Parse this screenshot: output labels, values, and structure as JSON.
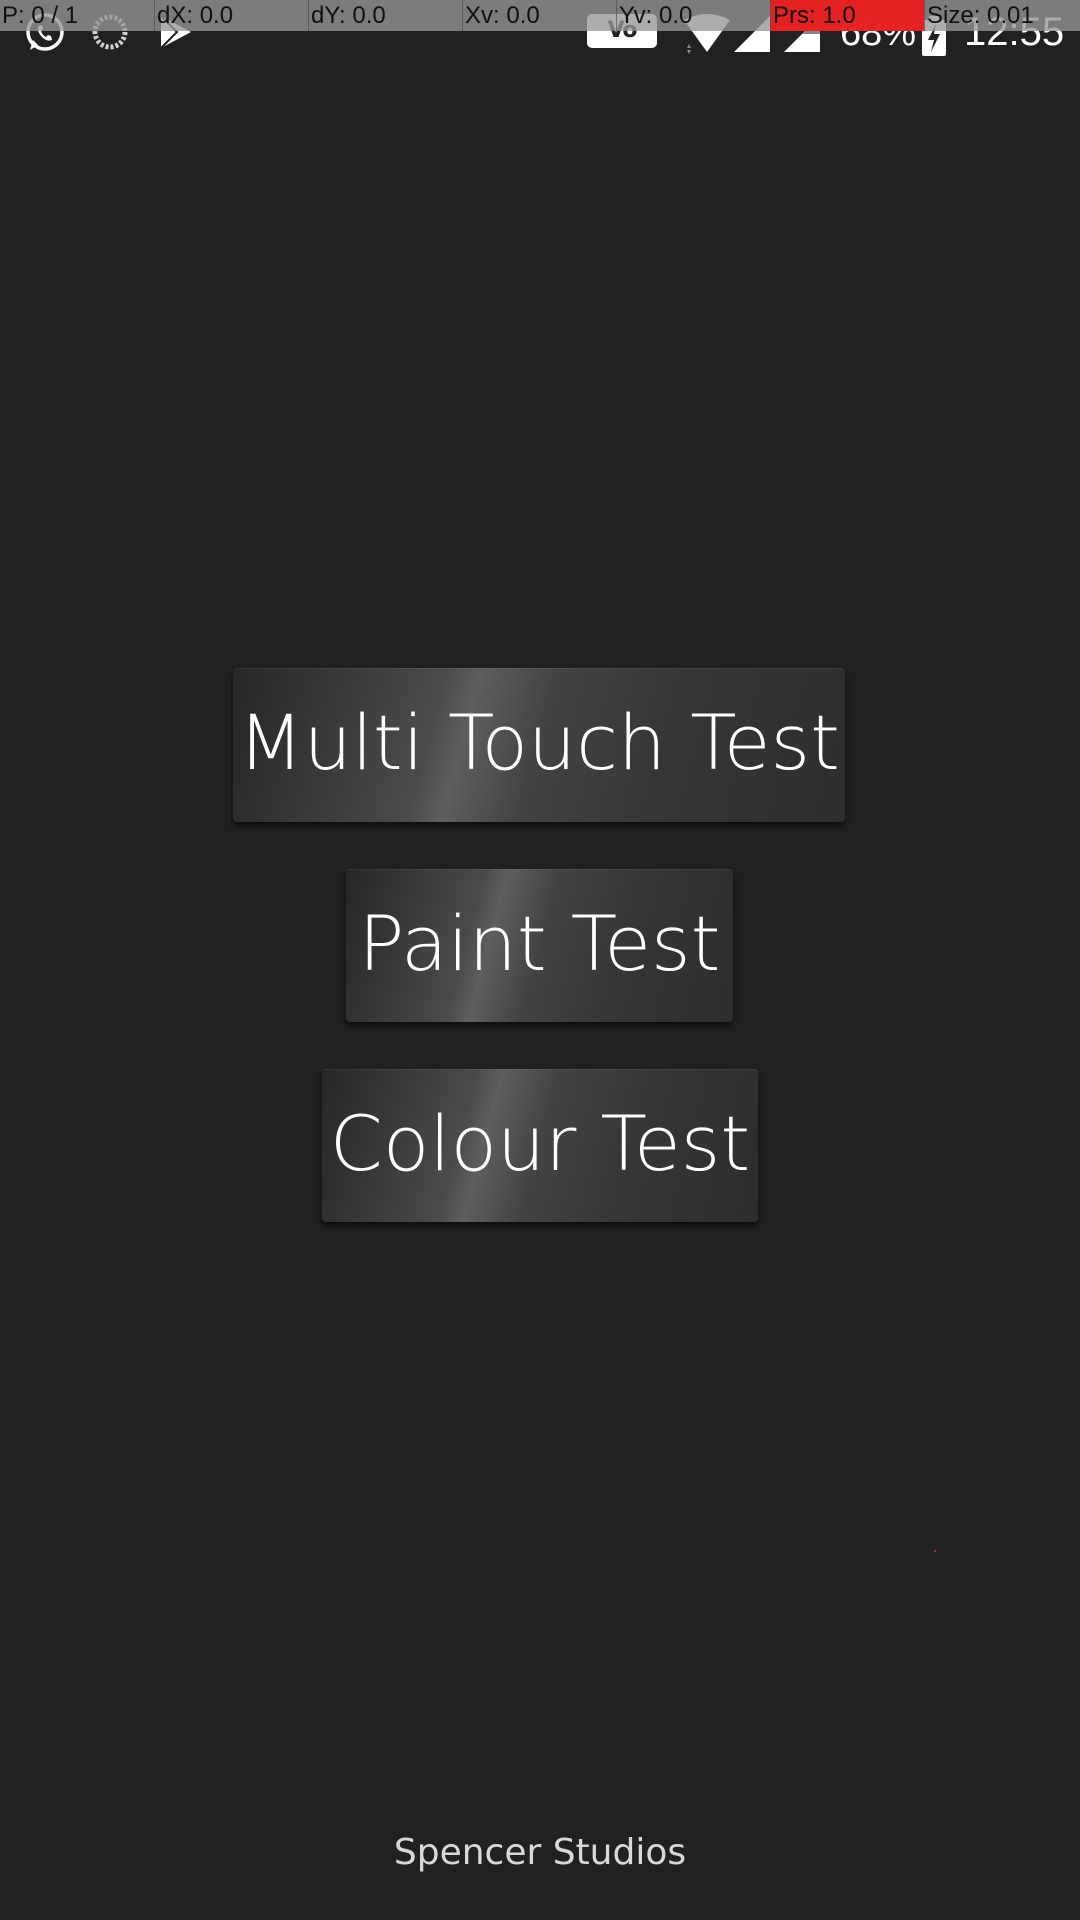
{
  "status_bar": {
    "icons": [
      "whatsapp-icon",
      "loading-icon",
      "play-store-icon",
      "wifi-icon",
      "signal-icon",
      "signal-icon",
      "battery-charging-icon"
    ],
    "volte": "Vo LTE",
    "battery_percent": "68%",
    "time": "12:55"
  },
  "pointer_overlay": {
    "cells": [
      "P: 0 / 1",
      "dX: 0.0",
      "dY: 0.0",
      "Xv: 0.0",
      "Yv: 0.0",
      "Prs: 1.0",
      "Size: 0.01"
    ],
    "highlight_color": "#e52222"
  },
  "menu": {
    "multi_touch_label": "Multi Touch Test",
    "paint_label": "Paint Test",
    "colour_label": "Colour Test"
  },
  "footer": {
    "credit": "Spencer Studios"
  },
  "colors": {
    "background": "#212121",
    "button_text": "#ffffff"
  }
}
